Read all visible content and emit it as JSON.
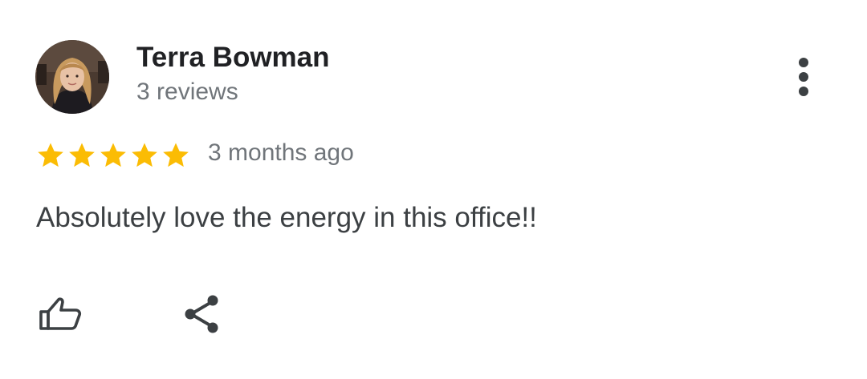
{
  "review": {
    "reviewer_name": "Terra Bowman",
    "review_count": "3 reviews",
    "rating": 5,
    "rating_max": 5,
    "time": "3 months ago",
    "text": "Absolutely love the energy in this office!!"
  },
  "icons": {
    "more": "more-vert-icon",
    "star": "star-icon",
    "like": "thumbs-up-icon",
    "share": "share-icon"
  },
  "colors": {
    "star": "#fbbc04",
    "name": "#202124",
    "secondary_text": "#70757a",
    "body_text": "#3c4043",
    "icon": "#3c4043"
  }
}
